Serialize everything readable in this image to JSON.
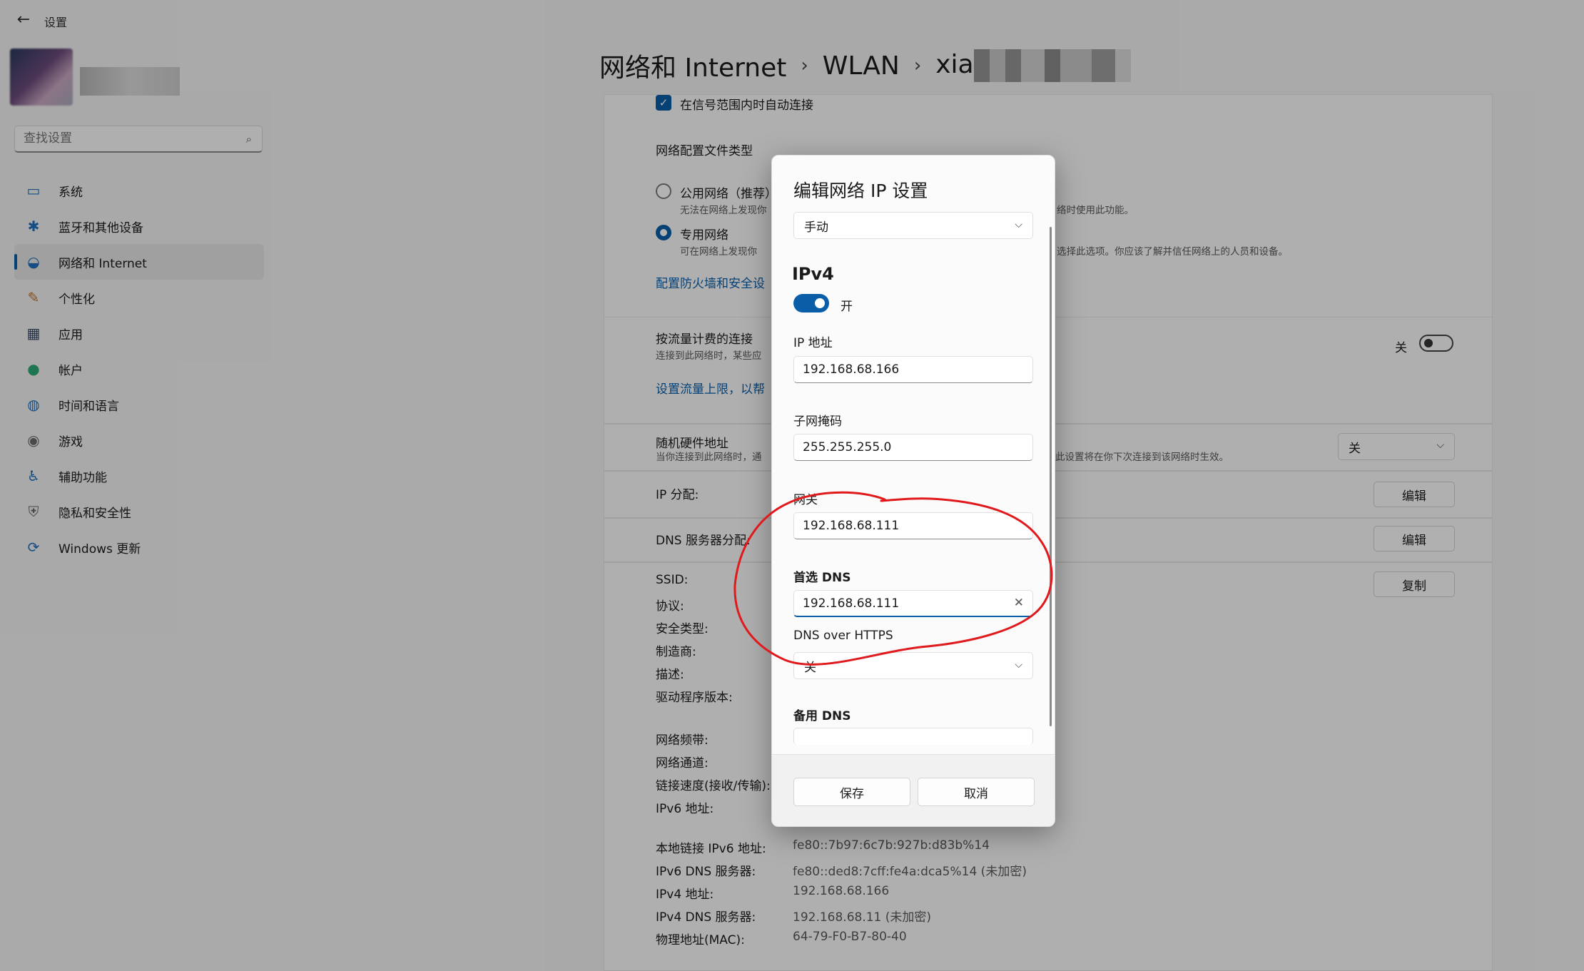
{
  "window": {
    "title": "设置",
    "back_label": "←"
  },
  "search": {
    "placeholder": "查找设置"
  },
  "nav": [
    {
      "label": "系统",
      "icon": "monitor-icon",
      "glyph": "▭",
      "color": "#1f6fbf"
    },
    {
      "label": "蓝牙和其他设备",
      "icon": "bluetooth-icon",
      "glyph": "✱",
      "color": "#1f6fbf"
    },
    {
      "label": "网络和 Internet",
      "icon": "wifi-icon",
      "glyph": "◒",
      "color": "#1f6fbf",
      "active": true
    },
    {
      "label": "个性化",
      "icon": "brush-icon",
      "glyph": "✎",
      "color": "#c0702c"
    },
    {
      "label": "应用",
      "icon": "apps-icon",
      "glyph": "▦",
      "color": "#3a4a6a"
    },
    {
      "label": "帐户",
      "icon": "account-icon",
      "glyph": "●",
      "color": "#2aa876"
    },
    {
      "label": "时间和语言",
      "icon": "globe-clock-icon",
      "glyph": "◍",
      "color": "#1f6fbf"
    },
    {
      "label": "游戏",
      "icon": "gamepad-icon",
      "glyph": "◉",
      "color": "#6a6a6a"
    },
    {
      "label": "辅助功能",
      "icon": "accessibility-icon",
      "glyph": "♿",
      "color": "#1f6fbf"
    },
    {
      "label": "隐私和安全性",
      "icon": "shield-icon",
      "glyph": "⛨",
      "color": "#6a6a6a"
    },
    {
      "label": "Windows 更新",
      "icon": "update-icon",
      "glyph": "⟳",
      "color": "#1f6fbf"
    }
  ],
  "breadcrumb": {
    "part1": "网络和 Internet",
    "sep": "›",
    "part2": "WLAN",
    "part3": "xia"
  },
  "settings": {
    "auto_connect": "在信号范围内时自动连接",
    "profile_type_heading": "网络配置文件类型",
    "public_label": "公用网络（推荐）",
    "public_desc": "无法在网络上发现你",
    "public_desc_tail": "络时使用此功能。",
    "private_label": "专用网络",
    "private_desc": "可在网络上发现你",
    "private_desc_tail": "选择此选项。你应该了解并信任网络上的人员和设备。",
    "firewall_link": "配置防火墙和安全设",
    "metered_label": "按流量计费的连接",
    "metered_desc": "连接到此网络时，某些应",
    "metered_state": "关",
    "data_limit_link": "设置流量上限，以帮",
    "random_hw_label": "随机硬件地址",
    "random_hw_desc": "当你连接到此网络时，通",
    "random_hw_desc_tail": "此设置将在你下次连接到该网络时生效。",
    "random_hw_value": "关",
    "ip_assign_label": "IP 分配:",
    "dns_assign_label": "DNS 服务器分配:",
    "edit_label": "编辑",
    "copy_label": "复制"
  },
  "properties": {
    "labels_top": [
      "SSID:",
      "协议:",
      "安全类型:",
      "制造商:",
      "描述:",
      "驱动程序版本:"
    ],
    "labels_mid": [
      "网络频带:",
      "网络通道:",
      "链接速度(接收/传输):",
      "IPv6 地址:"
    ],
    "rows_bottom": [
      {
        "label": "本地链接 IPv6 地址:",
        "value": "fe80::7b97:6c7b:927b:d83b%14"
      },
      {
        "label": "IPv6 DNS 服务器:",
        "value": "fe80::ded8:7cff:fe4a:dca5%14 (未加密)"
      },
      {
        "label": "IPv4 地址:",
        "value": "192.168.68.166"
      },
      {
        "label": "IPv4 DNS 服务器:",
        "value": "192.168.68.11 (未加密)"
      },
      {
        "label": "物理地址(MAC):",
        "value": "64-79-F0-B7-80-40"
      }
    ]
  },
  "dialog": {
    "title": "编辑网络 IP 设置",
    "mode": "手动",
    "ipv4_heading": "IPv4",
    "ipv4_toggle": "开",
    "ip_label": "IP 地址",
    "ip_value": "192.168.68.166",
    "mask_label": "子网掩码",
    "mask_value": "255.255.255.0",
    "gateway_label": "网关",
    "gateway_value": "192.168.68.111",
    "dns_label": "首选 DNS",
    "dns_value": "192.168.68.111",
    "doh_label": "DNS over HTTPS",
    "doh_value": "关",
    "alt_dns_label": "备用 DNS",
    "save": "保存",
    "cancel": "取消"
  },
  "annotation_color": "#e0191c"
}
